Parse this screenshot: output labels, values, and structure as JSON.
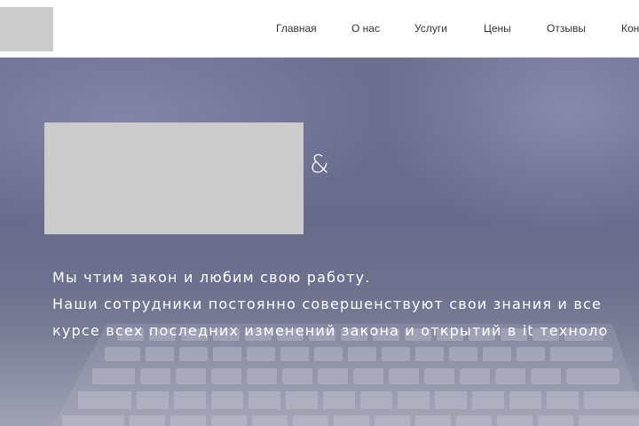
{
  "nav": {
    "items": [
      {
        "label": "Главная"
      },
      {
        "label": "О нас"
      },
      {
        "label": "Услуги"
      },
      {
        "label": "Цены"
      },
      {
        "label": "Отзывы"
      },
      {
        "label": "Кон"
      }
    ]
  },
  "hero": {
    "ampersand": "&",
    "lines": [
      "Мы чтим закон и любим свою работу.",
      "Наши сотрудники постоянно совершенствуют свои знания и все",
      "курсе всех последних изменений закона и открытий в it техноло"
    ]
  }
}
